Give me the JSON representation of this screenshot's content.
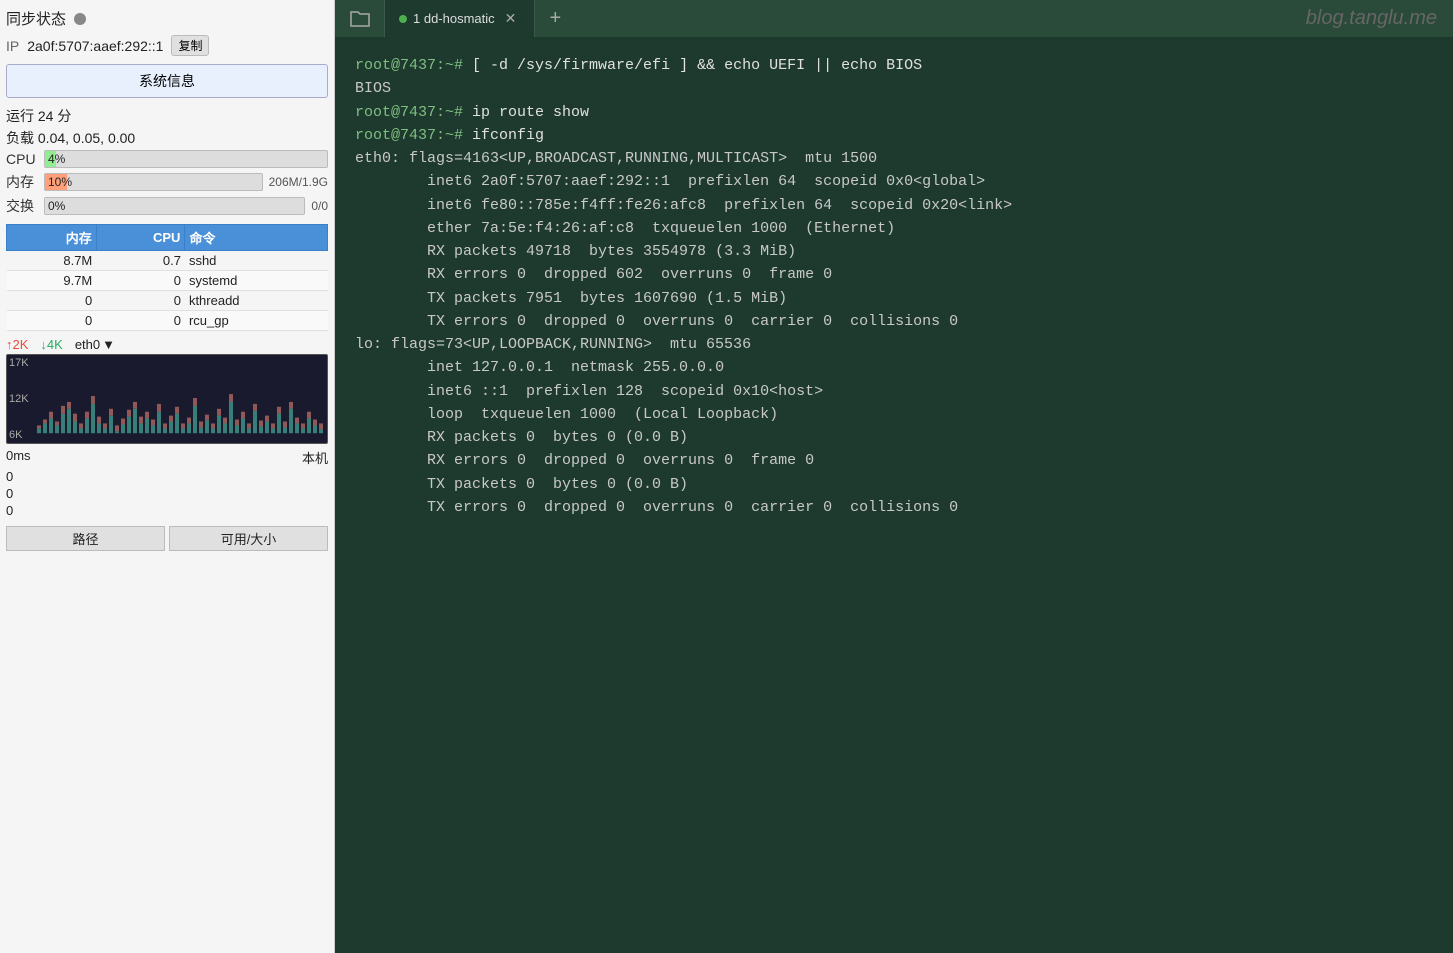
{
  "leftPanel": {
    "sync": {
      "label": "同步状态",
      "dotColor": "#888"
    },
    "ip": {
      "label": "IP",
      "value": "2a0f:5707:aaef:292::1",
      "copyLabel": "复制"
    },
    "sysinfoBtn": "系统信息",
    "uptime": "运行 24 分",
    "load": "负载 0.04, 0.05, 0.00",
    "cpu": {
      "label": "CPU",
      "percent": 4,
      "displayText": "4%"
    },
    "mem": {
      "label": "内存",
      "percent": 10,
      "displayText": "10%",
      "extra": "206M/1.9G"
    },
    "swap": {
      "label": "交换",
      "percent": 0,
      "displayText": "0%",
      "extra": "0/0"
    },
    "procTable": {
      "headers": [
        "内存",
        "CPU",
        "命令"
      ],
      "rows": [
        {
          "mem": "8.7M",
          "cpu": "0.7",
          "cmd": "sshd"
        },
        {
          "mem": "9.7M",
          "cpu": "0",
          "cmd": "systemd"
        },
        {
          "mem": "0",
          "cpu": "0",
          "cmd": "kthreadd"
        },
        {
          "mem": "0",
          "cpu": "0",
          "cmd": "rcu_gp"
        }
      ]
    },
    "network": {
      "upArrow": "↑",
      "upValue": "2K",
      "downArrow": "↓",
      "downValue": "4K",
      "iface": "eth0",
      "ifaceArrow": "▼",
      "yLabels": [
        "17K",
        "12K",
        "6K"
      ]
    },
    "ping": {
      "left": "0ms",
      "right": "本机",
      "values": [
        "0",
        "0",
        "0"
      ]
    },
    "footer": {
      "col1": "路径",
      "col2": "可用/大小"
    }
  },
  "rightPanel": {
    "tabs": [
      {
        "icon": "folder",
        "isActive": false
      },
      {
        "dot": true,
        "label": "1  dd-hosmatic",
        "hasClose": true,
        "isActive": true
      }
    ],
    "addBtn": "+",
    "brand": "blog.tanglu.me",
    "terminal": {
      "lines": [
        {
          "type": "prompt",
          "text": "root@7437:~# [ -d /sys/firmware/efi ] && echo UEFI || echo BIOS"
        },
        {
          "type": "output",
          "text": "BIOS"
        },
        {
          "type": "prompt",
          "text": "root@7437:~# ip route show"
        },
        {
          "type": "prompt",
          "text": "root@7437:~# ifconfig"
        },
        {
          "type": "output",
          "text": "eth0: flags=4163<UP,BROADCAST,RUNNING,MULTICAST>  mtu 1500"
        },
        {
          "type": "output",
          "text": "        inet6 2a0f:5707:aaef:292::1  prefixlen 64  scopeid 0x0<global>"
        },
        {
          "type": "output",
          "text": "        inet6 fe80::785e:f4ff:fe26:afc8  prefixlen 64  scopeid 0x20<link>"
        },
        {
          "type": "output",
          "text": "        ether 7a:5e:f4:26:af:c8  txqueuelen 1000  (Ethernet)"
        },
        {
          "type": "output",
          "text": "        RX packets 49718  bytes 3554978 (3.3 MiB)"
        },
        {
          "type": "output",
          "text": "        RX errors 0  dropped 602  overruns 0  frame 0"
        },
        {
          "type": "output",
          "text": "        TX packets 7951  bytes 1607690 (1.5 MiB)"
        },
        {
          "type": "output",
          "text": "        TX errors 0  dropped 0  overruns 0  carrier 0  collisions 0"
        },
        {
          "type": "output",
          "text": ""
        },
        {
          "type": "output",
          "text": "lo: flags=73<UP,LOOPBACK,RUNNING>  mtu 65536"
        },
        {
          "type": "output",
          "text": "        inet 127.0.0.1  netmask 255.0.0.0"
        },
        {
          "type": "output",
          "text": "        inet6 ::1  prefixlen 128  scopeid 0x10<host>"
        },
        {
          "type": "output",
          "text": "        loop  txqueuelen 1000  (Local Loopback)"
        },
        {
          "type": "output",
          "text": "        RX packets 0  bytes 0 (0.0 B)"
        },
        {
          "type": "output",
          "text": "        RX errors 0  dropped 0  overruns 0  frame 0"
        },
        {
          "type": "output",
          "text": "        TX packets 0  bytes 0 (0.0 B)"
        },
        {
          "type": "output",
          "text": "        TX errors 0  dropped 0  overruns 0  carrier 0  collisions 0"
        }
      ]
    }
  }
}
